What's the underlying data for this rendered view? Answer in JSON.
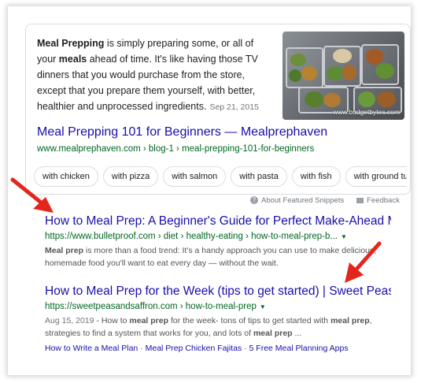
{
  "featured": {
    "snippet_bold1": "Meal Prepping",
    "snippet_text1": " is simply preparing some, or all of your ",
    "snippet_bold2": "meals",
    "snippet_text2": " ahead of time. It's like having those TV dinners that you would purchase from the store, except that you prepare them yourself, with better, healthier and unprocessed ingredients.",
    "date": "Sep 21, 2015",
    "image_credit": "www.budgetbytes.com",
    "title": "Meal Prepping 101 for Beginners — Mealprephaven",
    "url": "www.mealprephaven.com › blog-1 › meal-prepping-101-for-beginners",
    "chips": [
      "with chicken",
      "with pizza",
      "with salmon",
      "with pasta",
      "with fish",
      "with ground turkey"
    ]
  },
  "feedback_bar": {
    "about": "About Featured Snippets",
    "feedback": "Feedback"
  },
  "results": [
    {
      "title": "How to Meal Prep: A Beginner's Guide for Perfect Make-Ahead Me...",
      "url": "https://www.bulletproof.com › diet › healthy-eating › how-to-meal-prep-b...",
      "desc_bold": "Meal prep",
      "desc": " is more than a food trend: It's a handy approach you can use to make delicious, homemade food you'll want to eat every day — without the wait."
    },
    {
      "title": "How to Meal Prep for the Week (tips to get started) | Sweet Peas a...",
      "url": "https://sweetpeasandsaffron.com › how-to-meal-prep",
      "date": "Aug 15, 2019",
      "desc_a": " - How to ",
      "desc_b1": "meal prep",
      "desc_c": " for the week- tons of tips to get started with ",
      "desc_b2": "meal prep",
      "desc_d": ", strategies to find a system that works for you, and lots of ",
      "desc_b3": "meal prep",
      "desc_e": " ...",
      "sitelinks": [
        "How to Write a Meal Plan",
        "Meal Prep Chicken Fajitas",
        "5 Free Meal Planning Apps"
      ],
      "sitelink_sep": " · "
    }
  ],
  "colors": {
    "link": "#1a0dab",
    "url": "#006621",
    "arrow": "#e3261d"
  }
}
